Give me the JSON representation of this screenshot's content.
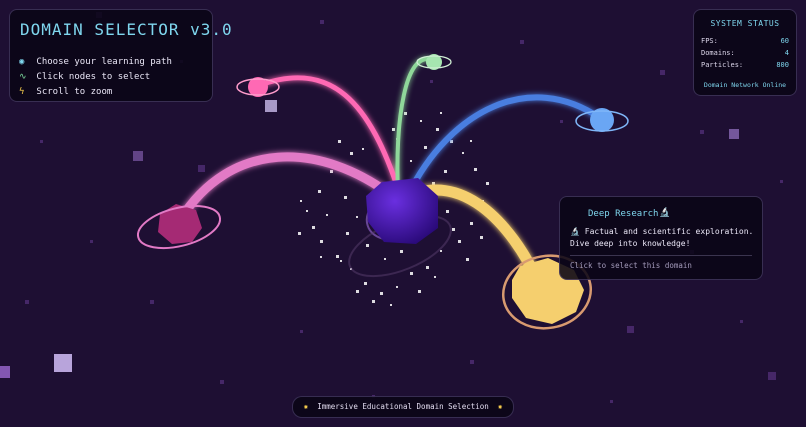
{
  "app": {
    "title": "DOMAIN SELECTOR v3.0",
    "instructions": [
      {
        "icon": "eye-icon",
        "glyph": "👁",
        "text": "Choose your learning path"
      },
      {
        "icon": "pulse-icon",
        "glyph": "⚡",
        "text": "Click nodes to select"
      },
      {
        "icon": "zap-icon",
        "glyph": "⚡",
        "text": "Scroll to zoom"
      }
    ]
  },
  "status": {
    "title": "SYSTEM STATUS",
    "rows": [
      {
        "label": "FPS:",
        "value": "60"
      },
      {
        "label": "Domains:",
        "value": "4"
      },
      {
        "label": "Particles:",
        "value": "800"
      }
    ],
    "footer": "Domain Network Online"
  },
  "tooltip": {
    "title": "Deep Research",
    "title_icon": "🔬",
    "description": "🔬 Factual and scientific exploration. Dive deep into knowledge!",
    "cta": "Click to select this domain"
  },
  "footer": {
    "star": "✸",
    "text": "Immersive Educational Domain Selection"
  },
  "colors": {
    "background": "#1e0f33",
    "core": "#3f0fa8",
    "pink": "#ff69b4",
    "magenta": "#b5307e",
    "green": "#8fd89a",
    "blue": "#4a7ee0",
    "gold": "#f5cf6e",
    "accent": "#7fd6ee"
  }
}
